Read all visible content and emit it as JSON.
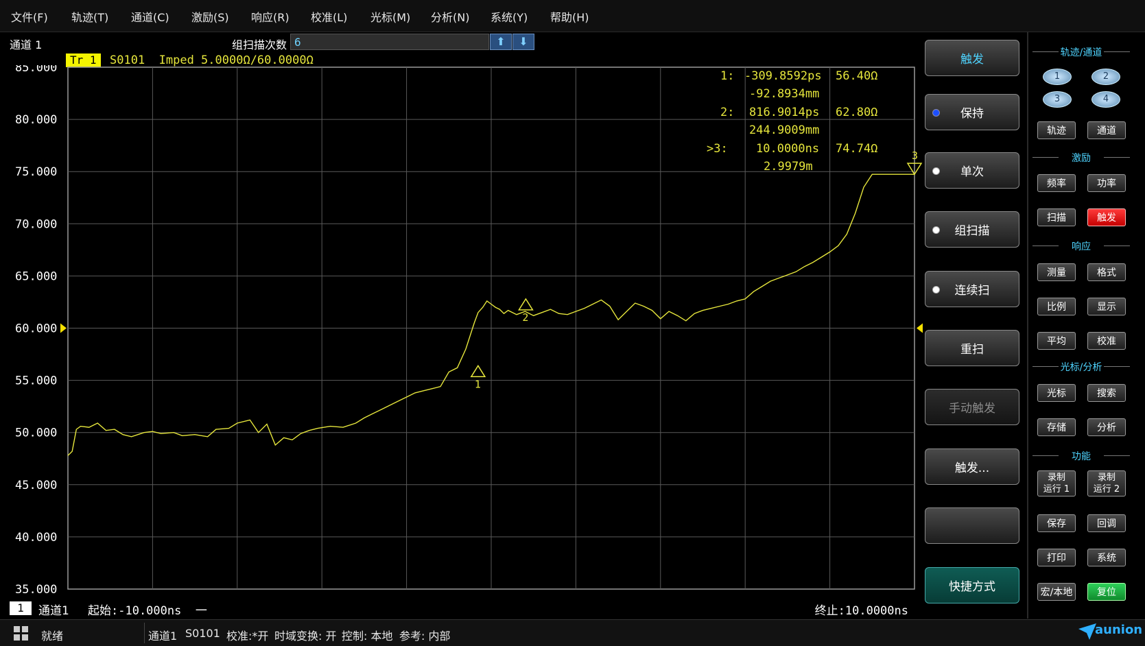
{
  "menu": [
    "文件(F)",
    "轨迹(T)",
    "通道(C)",
    "激励(S)",
    "响应(R)",
    "校准(L)",
    "光标(M)",
    "分析(N)",
    "系统(Y)",
    "帮助(H)"
  ],
  "header": {
    "channel": "通道 1",
    "scan_label": "组扫描次数",
    "scan_value": "6"
  },
  "trace": {
    "badge": "Tr 1",
    "info": "S0101  Imped 5.0000Ω/60.0000Ω"
  },
  "chart_data": {
    "type": "line",
    "y_ticks": [
      "85.000",
      "80.000",
      "75.000",
      "70.000",
      "65.000",
      "60.000",
      "55.000",
      "50.000",
      "45.000",
      "40.000",
      "35.000"
    ],
    "xlim": [
      -10,
      10
    ],
    "ylim": [
      35,
      85
    ],
    "x_unit": "ns",
    "y_unit": "Ω",
    "reference_level": 60,
    "grid": true,
    "series": [
      {
        "x": [
          -10,
          -9.9,
          -9.8,
          -9.7,
          -9.5,
          -9.3,
          -9.1,
          -8.9,
          -8.7,
          -8.5,
          -8.2,
          -8.0,
          -7.8,
          -7.5,
          -7.3,
          -7.0,
          -6.7,
          -6.5,
          -6.2,
          -6.0,
          -5.7,
          -5.5,
          -5.3,
          -5.1,
          -4.9,
          -4.7,
          -4.5,
          -4.3,
          -4.1,
          -3.8,
          -3.5,
          -3.2,
          -3.0,
          -2.8,
          -2.6,
          -2.4,
          -2.2,
          -2.0,
          -1.8,
          -1.6,
          -1.4,
          -1.2,
          -1.0,
          -0.8,
          -0.6,
          -0.4,
          -0.31,
          -0.2,
          -0.1,
          0.0,
          0.1,
          0.2,
          0.3,
          0.4,
          0.6,
          0.8,
          1.0,
          1.2,
          1.4,
          1.6,
          1.8,
          2.0,
          2.2,
          2.4,
          2.6,
          2.8,
          3.0,
          3.2,
          3.4,
          3.6,
          3.8,
          4.0,
          4.2,
          4.4,
          4.6,
          4.8,
          5.0,
          5.2,
          5.4,
          5.6,
          5.8,
          6.0,
          6.2,
          6.4,
          6.6,
          6.8,
          7.0,
          7.2,
          7.4,
          7.6,
          7.8,
          8.0,
          8.2,
          8.4,
          8.6,
          8.8,
          9.0,
          9.2,
          9.4,
          9.6,
          9.7,
          9.8,
          9.9,
          10.0
        ],
        "y": [
          47.8,
          48.2,
          50.3,
          50.6,
          50.5,
          50.9,
          50.2,
          50.3,
          49.8,
          49.6,
          50.0,
          50.1,
          49.9,
          50.0,
          49.7,
          49.8,
          49.6,
          50.3,
          50.4,
          50.9,
          51.2,
          50.0,
          50.8,
          48.8,
          49.5,
          49.3,
          49.9,
          50.2,
          50.4,
          50.6,
          50.5,
          50.9,
          51.4,
          51.8,
          52.2,
          52.6,
          53.0,
          53.4,
          53.8,
          54.0,
          54.2,
          54.4,
          55.8,
          56.2,
          58.0,
          60.5,
          61.5,
          62.0,
          62.6,
          62.3,
          62.0,
          61.8,
          61.4,
          61.7,
          61.3,
          61.6,
          61.2,
          61.5,
          61.8,
          61.4,
          61.3,
          61.6,
          61.9,
          62.3,
          62.7,
          62.1,
          60.8,
          61.6,
          62.4,
          62.1,
          61.7,
          60.9,
          61.6,
          61.2,
          60.7,
          61.4,
          61.7,
          61.9,
          62.1,
          62.3,
          62.6,
          62.8,
          63.5,
          64.0,
          64.5,
          64.8,
          65.1,
          65.4,
          65.9,
          66.3,
          66.8,
          67.3,
          67.9,
          69.0,
          71.0,
          73.5,
          74.74,
          74.74,
          74.74,
          74.74,
          74.74,
          74.74,
          74.74,
          74.74
        ]
      }
    ],
    "markers": [
      {
        "id": "1",
        "x": -0.31,
        "y": 56.4,
        "label": "1"
      },
      {
        "id": "2",
        "x": 0.817,
        "y": 62.8,
        "label": "2"
      },
      {
        "id": "3",
        "x": 10.0,
        "y": 74.74,
        "label": "3"
      }
    ]
  },
  "markers_readout": [
    {
      "id": "1:",
      "time": "-309.8592ps",
      "value": "56.40Ω",
      "dist": "-92.8934mm"
    },
    {
      "id": "2:",
      "time": "816.9014ps",
      "value": "62.80Ω",
      "dist": "244.9009mm"
    },
    {
      "id": ">3:",
      "time": "10.0000ns",
      "value": "74.74Ω",
      "dist": "2.9979m"
    }
  ],
  "bottom": {
    "ch_num": "1",
    "ch_name": "通道1",
    "start": "起始:-10.000ns",
    "start_dash": "一",
    "stop": "终止:10.0000ns"
  },
  "status": {
    "ready": "就绪",
    "channel": "通道1",
    "param": "S0101",
    "cal": "校准:*开",
    "tdt": "时域变换: 开",
    "control": "控制: 本地",
    "ref": "参考: 内部",
    "logo": "aunion"
  },
  "softkeys": [
    "触发",
    "保持",
    "单次",
    "组扫描",
    "连续扫",
    "重扫",
    "手动触发",
    "触发...",
    "",
    "快捷方式"
  ],
  "panel": {
    "sec1": "轨迹/通道",
    "ovals": [
      "1",
      "2",
      "3",
      "4"
    ],
    "trace_btn": "轨迹",
    "chan_btn": "通道",
    "sec2": "激励",
    "freq": "频率",
    "power": "功率",
    "sweep": "扫描",
    "trigger": "触发",
    "sec3": "响应",
    "measure": "测量",
    "format": "格式",
    "scale": "比例",
    "display": "显示",
    "avg": "平均",
    "cal": "校准",
    "sec4": "光标/分析",
    "marker": "光标",
    "search": "搜索",
    "store": "存储",
    "analysis": "分析",
    "sec5": "功能",
    "rec1a": "录制",
    "rec1b": "运行 1",
    "rec2a": "录制",
    "rec2b": "运行 2",
    "save": "保存",
    "recall": "回调",
    "print": "打印",
    "system": "系统",
    "macro": "宏/本地",
    "preset": "复位"
  }
}
